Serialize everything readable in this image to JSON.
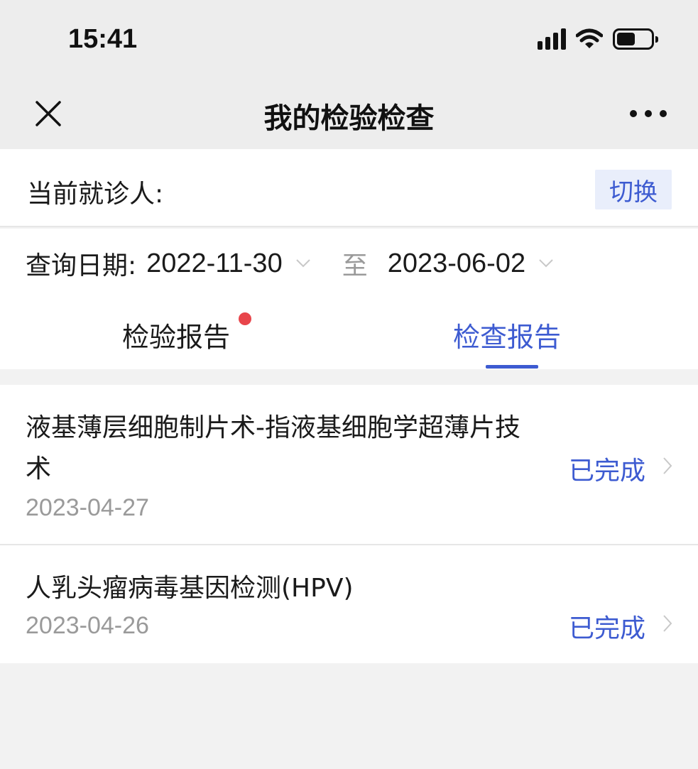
{
  "status_bar": {
    "time": "15:41"
  },
  "nav": {
    "title": "我的检验检查"
  },
  "patient": {
    "label": "当前就诊人:",
    "switch_label": "切换"
  },
  "filter": {
    "date_label": "查询日期:",
    "start_date": "2022-11-30",
    "separator": "至",
    "end_date": "2023-06-02"
  },
  "tabs": [
    {
      "label": "检验报告",
      "active": false,
      "has_badge": true
    },
    {
      "label": "检查报告",
      "active": true,
      "has_badge": false
    }
  ],
  "reports": [
    {
      "name": "液基薄层细胞制片术-指液基细胞学超薄片技术",
      "date": "2023-04-27",
      "status": "已完成"
    },
    {
      "name": "人乳头瘤病毒基因检测(HPV)",
      "date": "2023-04-26",
      "status": "已完成"
    }
  ],
  "colors": {
    "accent": "#3d5bd1",
    "badge": "#e8454b",
    "muted": "#9a9a9a"
  }
}
